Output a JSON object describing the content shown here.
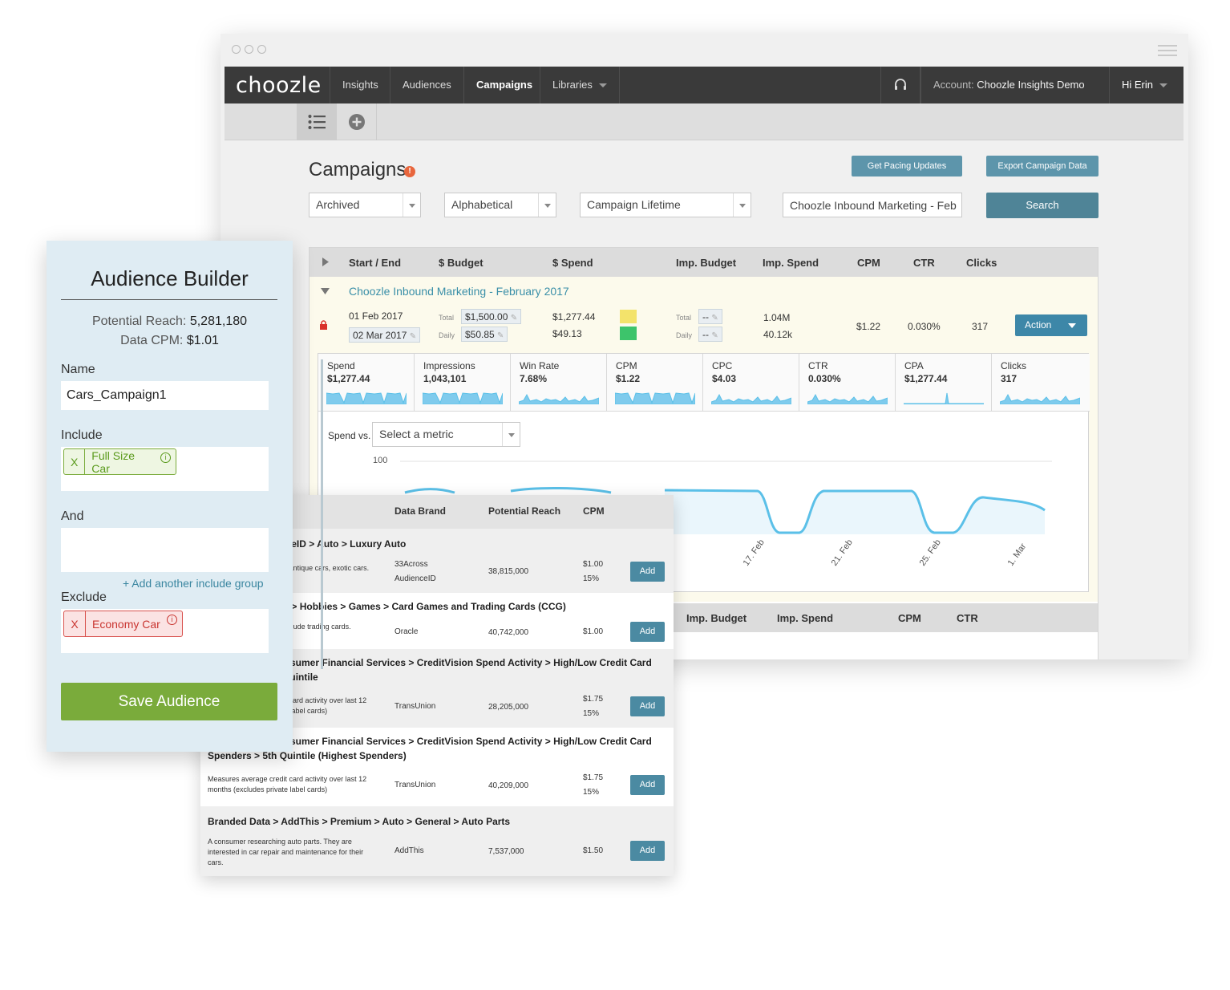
{
  "nav": {
    "logo": "choozle",
    "items": [
      "Insights",
      "Audiences",
      "Campaigns",
      "Libraries"
    ],
    "account_label": "Account:",
    "account_name": "Choozle Insights Demo",
    "user": "Hi Erin"
  },
  "campaigns": {
    "title": "Campaigns",
    "info_glyph": "!",
    "pacing_button": "Get Pacing Updates",
    "export_button": "Export Campaign Data",
    "filters": {
      "status": "Archived",
      "sort": "Alphabetical",
      "range": "Campaign Lifetime",
      "search_value": "Choozle Inbound Marketing - Feb",
      "search_button": "Search"
    },
    "columns": [
      "Start / End",
      "$ Budget",
      "$ Spend",
      "Imp. Budget",
      "Imp. Spend",
      "CPM",
      "CTR",
      "Clicks"
    ],
    "campaign": {
      "name": "Choozle Inbound Marketing - February 2017",
      "start": "01 Feb 2017",
      "end": "02 Mar 2017",
      "total_label": "Total",
      "daily_label": "Daily",
      "budget_total": "$1,500.00",
      "budget_daily": "$50.85",
      "spend_total": "$1,277.44",
      "spend_daily": "$49.13",
      "imp_budget_total": "--",
      "imp_budget_daily": "--",
      "imp_spend_total": "1.04M",
      "imp_spend_daily": "40.12k",
      "cpm": "$1.22",
      "ctr": "0.030%",
      "clicks": "317",
      "action_button": "Action"
    },
    "metrics": [
      {
        "label": "Spend",
        "value": "$1,277.44"
      },
      {
        "label": "Impressions",
        "value": "1,043,101"
      },
      {
        "label": "Win Rate",
        "value": "7.68%"
      },
      {
        "label": "CPM",
        "value": "$1.22"
      },
      {
        "label": "CPC",
        "value": "$4.03"
      },
      {
        "label": "CTR",
        "value": "0.030%"
      },
      {
        "label": "CPA",
        "value": "$1,277.44"
      },
      {
        "label": "Clicks",
        "value": "317"
      }
    ],
    "chart": {
      "spend_vs_label": "Spend vs.",
      "metric_select": "Select a metric",
      "y_tick": "100",
      "x_ticks": [
        "17. Feb",
        "21. Feb",
        "25. Feb",
        "1. Mar"
      ],
      "line_color": "#5bc0e8"
    },
    "lower_columns": [
      "Imp. Budget",
      "Imp. Spend",
      "CPM",
      "CTR"
    ]
  },
  "data_list": {
    "columns": [
      "Data Brand",
      "Potential Reach",
      "CPM"
    ],
    "rows": [
      {
        "path": "33Across AudienceID > Auto > Luxury Auto",
        "desc": "Interested in classic, and antique cars, exotic cars.",
        "brand": "33Across AudienceID",
        "reach": "38,815,000",
        "cpm": "$1.00",
        "pct": "15%"
      },
      {
        "path": "Oracle > Interests > Hobbies > Games > Card Games and Trading Cards (CCG)",
        "desc": "People whose hobbies include trading cards.",
        "brand": "Oracle",
        "reach": "40,742,000",
        "cpm": "$1.00",
        "pct": ""
      },
      {
        "path": "TransUnion > Consumer Financial Services > CreditVision Spend Activity > High/Low Credit Card Spenders > 2nd Quintile",
        "desc": "Measures average credit card activity over last 12 months (excludes private label cards)",
        "brand": "TransUnion",
        "reach": "28,205,000",
        "cpm": "$1.75",
        "pct": "15%"
      },
      {
        "path": "TransUnion > Consumer Financial Services > CreditVision Spend Activity > High/Low Credit Card Spenders > 5th Quintile (Highest Spenders)",
        "desc": "Measures average credit card activity over last 12 months (excludes private label cards)",
        "brand": "TransUnion",
        "reach": "40,209,000",
        "cpm": "$1.75",
        "pct": "15%"
      },
      {
        "path": "Branded Data > AddThis > Premium > Auto > General > Auto Parts",
        "desc": "A consumer researching auto parts. They are interested in car repair and maintenance for their cars.",
        "brand": "AddThis",
        "reach": "7,537,000",
        "cpm": "$1.50",
        "pct": ""
      }
    ],
    "add_label": "Add"
  },
  "builder": {
    "title": "Audience Builder",
    "reach_label": "Potential Reach:",
    "reach_value": "5,281,180",
    "cpm_label": "Data CPM:",
    "cpm_value": "$1.01",
    "name_label": "Name",
    "name_value": "Cars_Campaign1",
    "include_label": "Include",
    "include_tag": "Full Size Car",
    "and_label": "And",
    "add_group": "+ Add another include group",
    "exclude_label": "Exclude",
    "exclude_tag": "Economy Car",
    "remove_glyph": "X",
    "info_glyph": "i",
    "save_button": "Save Audience"
  },
  "colors": {
    "nav_bg": "#3a3a3a",
    "accent": "#4f8497",
    "include_green": "#7aab3b",
    "exclude_red": "#d9534f",
    "builder_bg": "#dfecf3"
  }
}
